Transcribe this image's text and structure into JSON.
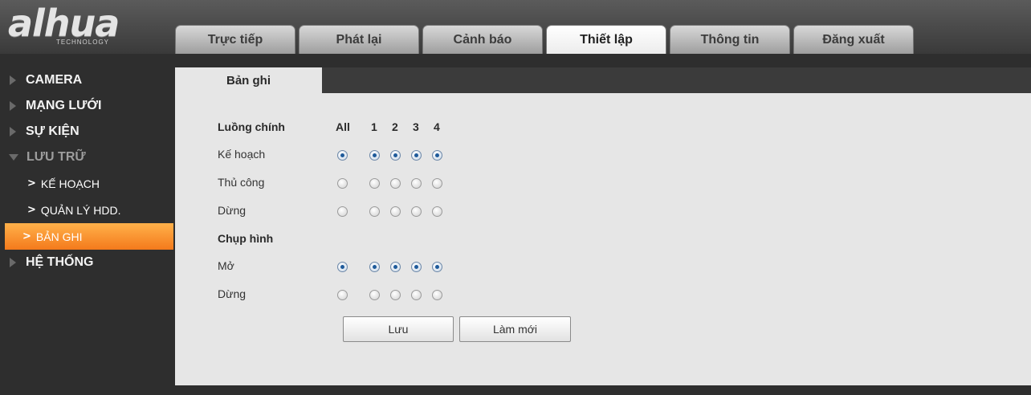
{
  "brand": {
    "logo": "alhua",
    "sub": "TECHNOLOGY"
  },
  "tabs": [
    {
      "label": "Trực tiếp"
    },
    {
      "label": "Phát lại"
    },
    {
      "label": "Cảnh báo"
    },
    {
      "label": "Thiết lập"
    },
    {
      "label": "Thông tin"
    },
    {
      "label": "Đăng xuất"
    }
  ],
  "active_tab": "Thiết lập",
  "sidebar": {
    "camera": "CAMERA",
    "network": "MẠNG LƯỚI",
    "event": "SỰ KIỆN",
    "storage": "LƯU TRỮ",
    "storage_sub": [
      {
        "label": "KẾ HOẠCH"
      },
      {
        "label": "QUẢN LÝ HDD."
      },
      {
        "label": "BẢN GHI"
      }
    ],
    "system": "HỆ THỐNG"
  },
  "panel": {
    "title": "Bản ghi",
    "main_stream_label": "Luồng chính",
    "columns": [
      "All",
      "1",
      "2",
      "3",
      "4"
    ],
    "rows": [
      {
        "label": "Kế hoạch",
        "checked": true
      },
      {
        "label": "Thủ công",
        "checked": false
      },
      {
        "label": "Dừng",
        "checked": false
      }
    ],
    "snapshot_label": "Chụp hình",
    "snapshot_rows": [
      {
        "label": "Mở",
        "checked": true
      },
      {
        "label": "Dừng",
        "checked": false
      }
    ],
    "save_button": "Lưu",
    "refresh_button": "Làm mới"
  },
  "colors": {
    "accent": "#f47a1c",
    "radio_selected": "#1e5a9a"
  }
}
